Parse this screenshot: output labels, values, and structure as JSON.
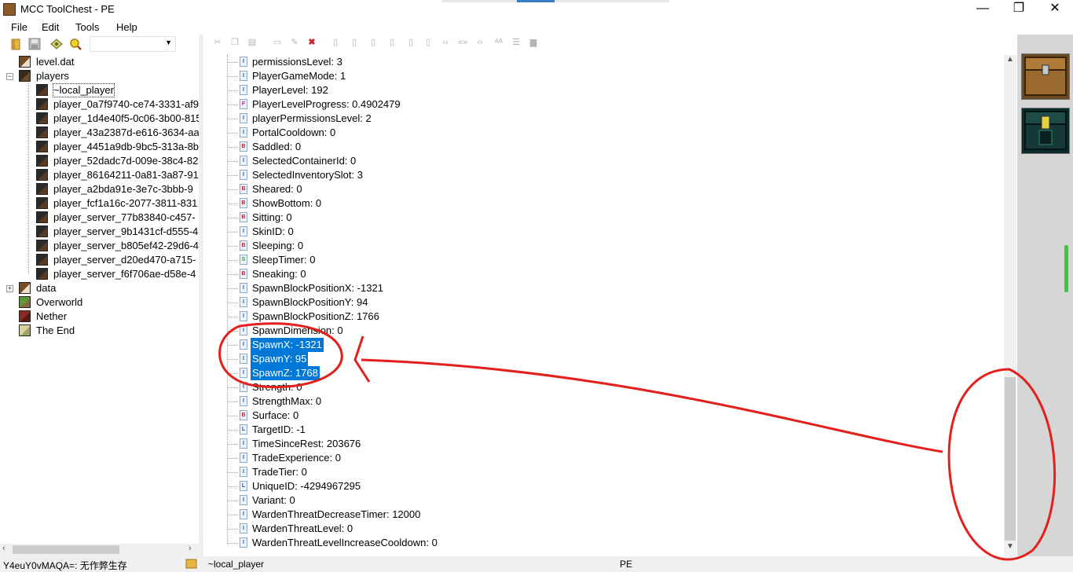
{
  "window": {
    "title": "MCC ToolChest - PE",
    "minimize_glyph": "—",
    "maximize_glyph": "❐",
    "close_glyph": "✕"
  },
  "menu": [
    "File",
    "Edit",
    "Tools",
    "Help"
  ],
  "left_tree": {
    "items": [
      {
        "label": "level.dat",
        "icon": "book-icon",
        "level": 0,
        "expander": ""
      },
      {
        "label": "players",
        "icon": "chest-icon",
        "level": 0,
        "expander": "−"
      },
      {
        "label": "~local_player",
        "icon": "player-icon",
        "level": 1,
        "expander": "",
        "selected": true
      },
      {
        "label": "player_0a7f9740-ce74-3331-af9",
        "icon": "player-icon",
        "level": 1,
        "expander": ""
      },
      {
        "label": "player_1d4e40f5-0c06-3b00-815",
        "icon": "player-icon",
        "level": 1,
        "expander": ""
      },
      {
        "label": "player_43a2387d-e616-3634-aa",
        "icon": "player-icon",
        "level": 1,
        "expander": ""
      },
      {
        "label": "player_4451a9db-9bc5-313a-8b",
        "icon": "player-icon",
        "level": 1,
        "expander": ""
      },
      {
        "label": "player_52dadc7d-009e-38c4-82",
        "icon": "player-icon",
        "level": 1,
        "expander": ""
      },
      {
        "label": "player_86164211-0a81-3a87-91",
        "icon": "player-icon",
        "level": 1,
        "expander": ""
      },
      {
        "label": "player_a2bda91e-3e7c-3bbb-9",
        "icon": "player-icon",
        "level": 1,
        "expander": ""
      },
      {
        "label": "player_fcf1a16c-2077-3811-831",
        "icon": "player-icon",
        "level": 1,
        "expander": ""
      },
      {
        "label": "player_server_77b83840-c457-",
        "icon": "player-icon",
        "level": 1,
        "expander": ""
      },
      {
        "label": "player_server_9b1431cf-d555-4",
        "icon": "player-icon",
        "level": 1,
        "expander": ""
      },
      {
        "label": "player_server_b805ef42-29d6-4",
        "icon": "player-icon",
        "level": 1,
        "expander": ""
      },
      {
        "label": "player_server_d20ed470-a715-",
        "icon": "player-icon",
        "level": 1,
        "expander": ""
      },
      {
        "label": "player_server_f6f706ae-d58e-4",
        "icon": "player-icon",
        "level": 1,
        "expander": ""
      },
      {
        "label": "data",
        "icon": "book-icon",
        "level": 0,
        "expander": "+"
      },
      {
        "label": "Overworld",
        "icon": "grass-block-icon",
        "level": 0,
        "expander": ""
      },
      {
        "label": "Nether",
        "icon": "netherrack-icon",
        "level": 0,
        "expander": ""
      },
      {
        "label": "The End",
        "icon": "endstone-icon",
        "level": 0,
        "expander": ""
      }
    ]
  },
  "right_tree": {
    "items": [
      {
        "label": "permissionsLevel: 3",
        "type": "I",
        "selected": false
      },
      {
        "label": "PlayerGameMode: 1",
        "type": "I",
        "selected": false
      },
      {
        "label": "PlayerLevel: 192",
        "type": "I",
        "selected": false
      },
      {
        "label": "PlayerLevelProgress: 0.4902479",
        "type": "F",
        "selected": false
      },
      {
        "label": "playerPermissionsLevel: 2",
        "type": "I",
        "selected": false
      },
      {
        "label": "PortalCooldown: 0",
        "type": "I",
        "selected": false
      },
      {
        "label": "Saddled: 0",
        "type": "B",
        "selected": false
      },
      {
        "label": "SelectedContainerId: 0",
        "type": "I",
        "selected": false
      },
      {
        "label": "SelectedInventorySlot: 3",
        "type": "I",
        "selected": false
      },
      {
        "label": "Sheared: 0",
        "type": "B",
        "selected": false
      },
      {
        "label": "ShowBottom: 0",
        "type": "B",
        "selected": false
      },
      {
        "label": "Sitting: 0",
        "type": "B",
        "selected": false
      },
      {
        "label": "SkinID: 0",
        "type": "I",
        "selected": false
      },
      {
        "label": "Sleeping: 0",
        "type": "B",
        "selected": false
      },
      {
        "label": "SleepTimer: 0",
        "type": "S",
        "selected": false
      },
      {
        "label": "Sneaking: 0",
        "type": "B",
        "selected": false
      },
      {
        "label": "SpawnBlockPositionX: -1321",
        "type": "I",
        "selected": false
      },
      {
        "label": "SpawnBlockPositionY: 94",
        "type": "I",
        "selected": false
      },
      {
        "label": "SpawnBlockPositionZ: 1766",
        "type": "I",
        "selected": false
      },
      {
        "label": "SpawnDimension: 0",
        "type": "I",
        "selected": false
      },
      {
        "label": "SpawnX: -1321",
        "type": "I",
        "selected": true
      },
      {
        "label": "SpawnY: 95",
        "type": "I",
        "selected": true
      },
      {
        "label": "SpawnZ: 1768",
        "type": "I",
        "selected": true
      },
      {
        "label": "Strength: 0",
        "type": "I",
        "selected": false
      },
      {
        "label": "StrengthMax: 0",
        "type": "I",
        "selected": false
      },
      {
        "label": "Surface: 0",
        "type": "B",
        "selected": false
      },
      {
        "label": "TargetID: -1",
        "type": "L",
        "selected": false
      },
      {
        "label": "TimeSinceRest: 203676",
        "type": "I",
        "selected": false
      },
      {
        "label": "TradeExperience: 0",
        "type": "I",
        "selected": false
      },
      {
        "label": "TradeTier: 0",
        "type": "I",
        "selected": false
      },
      {
        "label": "UniqueID: -4294967295",
        "type": "L",
        "selected": false
      },
      {
        "label": "Variant: 0",
        "type": "I",
        "selected": false
      },
      {
        "label": "WardenThreatDecreaseTimer: 12000",
        "type": "I",
        "selected": false
      },
      {
        "label": "WardenThreatLevel: 0",
        "type": "I",
        "selected": false
      },
      {
        "label": "WardenThreatLevelIncreaseCooldown: 0",
        "type": "I",
        "selected": false
      }
    ]
  },
  "status": {
    "world_name": "Y4euY0vMAQA=: 无作弊生存",
    "selected_path": "~local_player",
    "edition": "PE"
  },
  "colors": {
    "selection": "#0078d7",
    "annotation": "#e3201b"
  }
}
